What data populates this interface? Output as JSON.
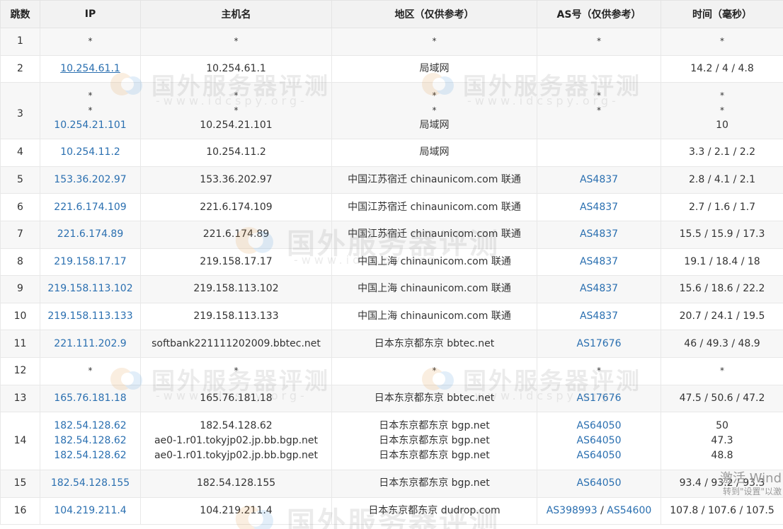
{
  "table": {
    "headers": [
      "跳数",
      "IP",
      "主机名",
      "地区（仅供参考）",
      "AS号（仅供参考）",
      "时间（毫秒）"
    ],
    "rows": [
      {
        "hop": "1",
        "ips": [
          "*"
        ],
        "hosts": [
          "*"
        ],
        "regions": [
          "*"
        ],
        "as": [
          "*"
        ],
        "times": [
          "*"
        ]
      },
      {
        "hop": "2",
        "ips": [
          "10.254.61.1"
        ],
        "hosts": [
          "10.254.61.1"
        ],
        "regions": [
          "局域网"
        ],
        "as": [
          ""
        ],
        "times": [
          "14.2 / 4 / 4.8"
        ]
      },
      {
        "hop": "3",
        "ips": [
          "*",
          "*",
          "10.254.21.101"
        ],
        "hosts": [
          "*",
          "*",
          "10.254.21.101"
        ],
        "regions": [
          "*",
          "*",
          "局域网"
        ],
        "as": [
          "*",
          "*",
          ""
        ],
        "times": [
          "*",
          "*",
          "10"
        ]
      },
      {
        "hop": "4",
        "ips": [
          "10.254.11.2"
        ],
        "hosts": [
          "10.254.11.2"
        ],
        "regions": [
          "局域网"
        ],
        "as": [
          ""
        ],
        "times": [
          "3.3 / 2.1 / 2.2"
        ]
      },
      {
        "hop": "5",
        "ips": [
          "153.36.202.97"
        ],
        "hosts": [
          "153.36.202.97"
        ],
        "regions": [
          "中国江苏宿迁 chinaunicom.com 联通"
        ],
        "as": [
          "AS4837"
        ],
        "times": [
          "2.8 / 4.1 / 2.1"
        ]
      },
      {
        "hop": "6",
        "ips": [
          "221.6.174.109"
        ],
        "hosts": [
          "221.6.174.109"
        ],
        "regions": [
          "中国江苏宿迁 chinaunicom.com 联通"
        ],
        "as": [
          "AS4837"
        ],
        "times": [
          "2.7 / 1.6 / 1.7"
        ]
      },
      {
        "hop": "7",
        "ips": [
          "221.6.174.89"
        ],
        "hosts": [
          "221.6.174.89"
        ],
        "regions": [
          "中国江苏宿迁 chinaunicom.com 联通"
        ],
        "as": [
          "AS4837"
        ],
        "times": [
          "15.5 / 15.9 / 17.3"
        ]
      },
      {
        "hop": "8",
        "ips": [
          "219.158.17.17"
        ],
        "hosts": [
          "219.158.17.17"
        ],
        "regions": [
          "中国上海 chinaunicom.com 联通"
        ],
        "as": [
          "AS4837"
        ],
        "times": [
          "19.1 / 18.4 / 18"
        ]
      },
      {
        "hop": "9",
        "ips": [
          "219.158.113.102"
        ],
        "hosts": [
          "219.158.113.102"
        ],
        "regions": [
          "中国上海 chinaunicom.com 联通"
        ],
        "as": [
          "AS4837"
        ],
        "times": [
          "15.6 / 18.6 / 22.2"
        ]
      },
      {
        "hop": "10",
        "ips": [
          "219.158.113.133"
        ],
        "hosts": [
          "219.158.113.133"
        ],
        "regions": [
          "中国上海 chinaunicom.com 联通"
        ],
        "as": [
          "AS4837"
        ],
        "times": [
          "20.7 / 24.1 / 19.5"
        ]
      },
      {
        "hop": "11",
        "ips": [
          "221.111.202.9"
        ],
        "hosts": [
          "softbank221111202009.bbtec.net"
        ],
        "regions": [
          "日本东京都东京 bbtec.net"
        ],
        "as": [
          "AS17676"
        ],
        "times": [
          "46 / 49.3 / 48.9"
        ]
      },
      {
        "hop": "12",
        "ips": [
          "*"
        ],
        "hosts": [
          "*"
        ],
        "regions": [
          "*"
        ],
        "as": [
          "*"
        ],
        "times": [
          "*"
        ]
      },
      {
        "hop": "13",
        "ips": [
          "165.76.181.18"
        ],
        "hosts": [
          "165.76.181.18"
        ],
        "regions": [
          "日本东京都东京 bbtec.net"
        ],
        "as": [
          "AS17676"
        ],
        "times": [
          "47.5 / 50.6 / 47.2"
        ]
      },
      {
        "hop": "14",
        "ips": [
          "182.54.128.62",
          "182.54.128.62",
          "182.54.128.62"
        ],
        "hosts": [
          "182.54.128.62",
          "ae0-1.r01.tokyjp02.jp.bb.bgp.net",
          "ae0-1.r01.tokyjp02.jp.bb.bgp.net"
        ],
        "regions": [
          "日本东京都东京 bgp.net",
          "日本东京都东京 bgp.net",
          "日本东京都东京 bgp.net"
        ],
        "as": [
          "AS64050",
          "AS64050",
          "AS64050"
        ],
        "times": [
          "50",
          "47.3",
          "48.8"
        ]
      },
      {
        "hop": "15",
        "ips": [
          "182.54.128.155"
        ],
        "hosts": [
          "182.54.128.155"
        ],
        "regions": [
          "日本东京都东京 bgp.net"
        ],
        "as": [
          "AS64050"
        ],
        "times": [
          "93.4 / 93.2 / 93.3"
        ]
      },
      {
        "hop": "16",
        "ips": [
          "104.219.211.4"
        ],
        "hosts": [
          "104.219.211.4"
        ],
        "regions": [
          "日本东京都东京 dudrop.com"
        ],
        "as": [
          "AS398993 / AS54600"
        ],
        "times": [
          "107.8 / 107.6 / 107.5"
        ]
      }
    ]
  },
  "watermark": {
    "title": "国外服务器评测",
    "url": "-www.idcspy.org-"
  },
  "os_overlay": {
    "line1": "激活 Wind",
    "line2": "转到\"设置\"以激"
  },
  "colors": {
    "link": "#2a6fb0",
    "header_bg": "#f2f2f2",
    "row_alt_bg": "#f7f7f7",
    "border": "#e8e8e8"
  }
}
